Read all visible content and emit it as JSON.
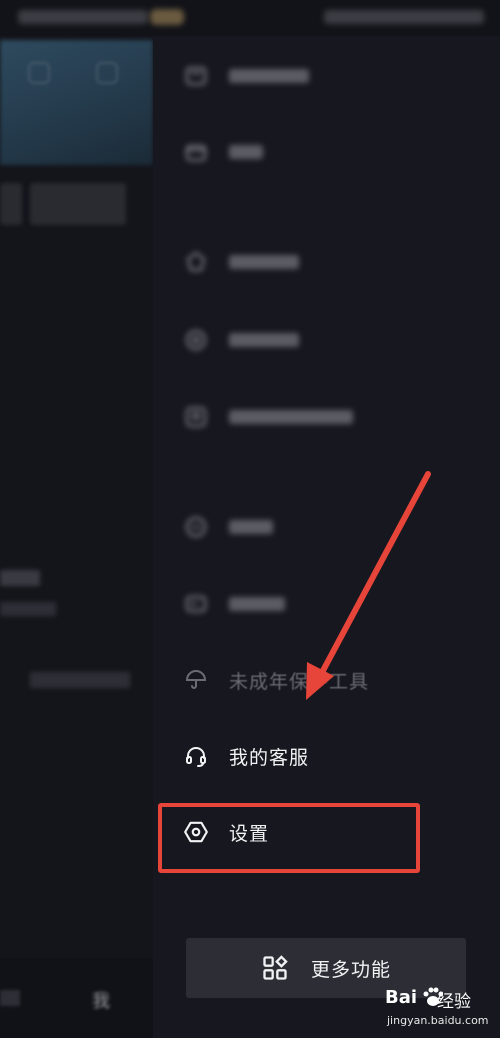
{
  "left_pane": {
    "tab_label": "我"
  },
  "drawer": {
    "items": [
      {
        "icon": "cart-icon",
        "label": ""
      },
      {
        "icon": "wallet-icon",
        "label": ""
      },
      {
        "icon": "shield-icon",
        "label": ""
      },
      {
        "icon": "circle-icon",
        "label": ""
      },
      {
        "icon": "badge-icon",
        "label": ""
      },
      {
        "icon": "miniapp-icon",
        "label": ""
      },
      {
        "icon": "card-icon",
        "label": ""
      },
      {
        "icon": "umbrella-icon",
        "label": "未成年保护工具"
      },
      {
        "icon": "headset-icon",
        "label": "我的客服"
      },
      {
        "icon": "settings-hexagon-icon",
        "label": "设置"
      }
    ],
    "more_button": {
      "icon": "grid-icon",
      "label": "更多功能"
    }
  },
  "annotation": {
    "highlight_color": "#e8453a",
    "arrow_color": "#e8453a"
  },
  "watermark": {
    "brand": "Bai",
    "brand_suffix": "经验",
    "url": "jingyan.baidu.com"
  }
}
